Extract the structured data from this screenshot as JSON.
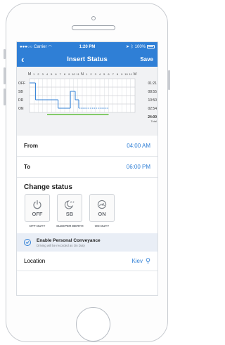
{
  "status_bar": {
    "carrier": "Carrier",
    "time": "1:20 PM",
    "battery": "100%"
  },
  "navbar": {
    "title": "Insert Status",
    "back_icon": "chevron-left-icon",
    "save_label": "Save"
  },
  "log_grid": {
    "hour_labels": [
      "M",
      "1",
      "2",
      "3",
      "4",
      "5",
      "6",
      "7",
      "8",
      "9",
      "10",
      "11",
      "N",
      "1",
      "2",
      "3",
      "4",
      "5",
      "6",
      "7",
      "8",
      "9",
      "10",
      "11",
      "M"
    ],
    "statuses": [
      "OFF",
      "SB",
      "DR",
      "ON"
    ],
    "totals": [
      "01:21",
      "08:55",
      "10:50",
      "02:54"
    ],
    "grand_total": "24:00",
    "grand_total_label": "Total"
  },
  "chart_data": {
    "type": "step",
    "statuses": [
      "OFF",
      "SB",
      "DR",
      "ON"
    ],
    "segments": [
      {
        "status": "OFF",
        "start": 0,
        "end": 1.35
      },
      {
        "status": "DR",
        "start": 1.35,
        "end": 6.5
      },
      {
        "status": "ON",
        "start": 6.5,
        "end": 9.3
      },
      {
        "status": "SB",
        "start": 9.3,
        "end": 10.4
      },
      {
        "status": "DR",
        "start": 10.4,
        "end": 11.2
      },
      {
        "status": "ON",
        "start": 11.2,
        "end": 18.0
      }
    ],
    "insert_range": [
      4,
      18
    ],
    "colors": {
      "line": "#2f7fd6",
      "insert_bar": "#6cc24a"
    }
  },
  "form": {
    "from_label": "From",
    "from_value": "04:00 AM",
    "to_label": "To",
    "to_value": "06:00 PM"
  },
  "change_status": {
    "title": "Change status",
    "options": [
      {
        "code": "OFF",
        "name": "OFF DUTY",
        "icon": "power-icon"
      },
      {
        "code": "SB",
        "name": "SLEEPER BERTH",
        "icon": "moon-icon"
      },
      {
        "code": "ON",
        "name": "ON DUTY",
        "icon": "gauge-icon"
      }
    ]
  },
  "personal_conveyance": {
    "title": "Enable Personal Conveyance",
    "note": "Driving will be recorded as On Duty"
  },
  "location": {
    "label": "Location",
    "value": "Kiev",
    "icon": "map-pin-icon"
  },
  "colors": {
    "accent": "#2f7fd6",
    "background": "#f1f2f4"
  }
}
